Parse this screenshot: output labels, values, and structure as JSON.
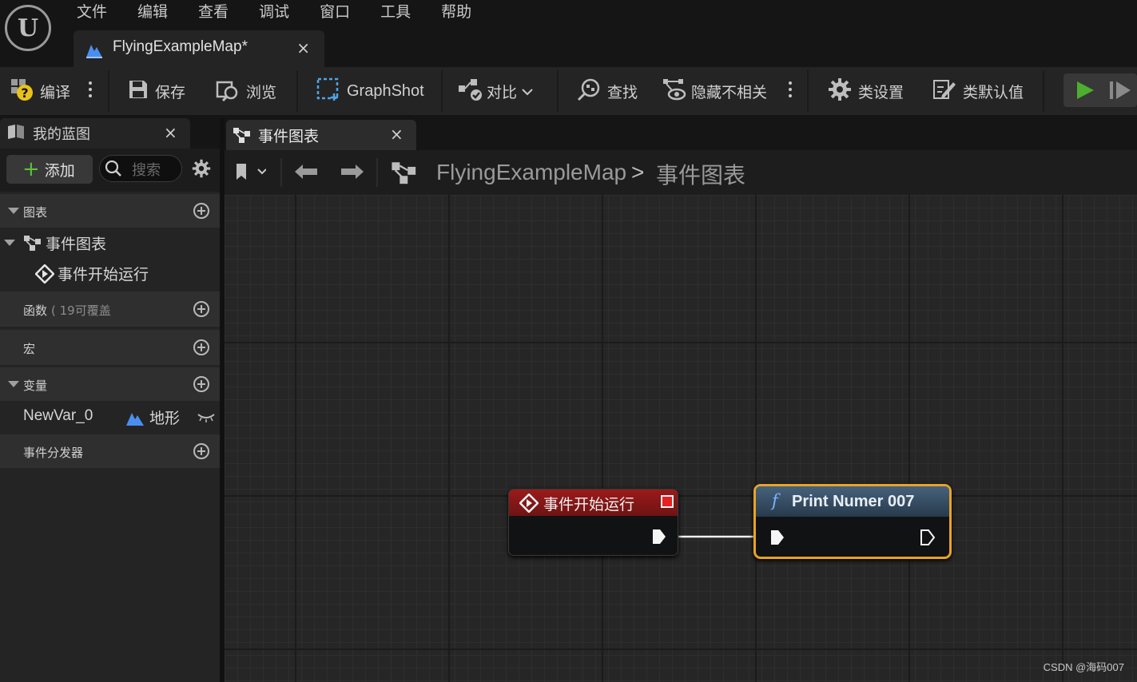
{
  "menu": [
    "文件",
    "编辑",
    "查看",
    "调试",
    "窗口",
    "工具",
    "帮助"
  ],
  "document_tab": {
    "label": "FlyingExampleMap*",
    "close": "×"
  },
  "toolbar": {
    "compile": "编译",
    "save": "保存",
    "browse": "浏览",
    "graphshot": "GraphShot",
    "diff": "对比",
    "find": "查找",
    "hide_unrelated": "隐藏不相关",
    "class_settings": "类设置",
    "class_defaults": "类默认值"
  },
  "my_blueprint": {
    "tab_label": "我的蓝图",
    "close": "×",
    "add_label": "添加",
    "search_placeholder": "搜索",
    "sections": {
      "graphs": "图表",
      "event_graph": "事件图表",
      "begin_play": "事件开始运行",
      "functions": "函数",
      "functions_count": "( 19可覆盖",
      "macros": "宏",
      "variables": "变量",
      "event_dispatchers": "事件分发器"
    },
    "variable": {
      "name": "NewVar_0",
      "type": "地形"
    }
  },
  "graph_tab": {
    "label": "事件图表",
    "close": "×"
  },
  "breadcrumb": {
    "root": "FlyingExampleMap",
    "separator": ">",
    "current": "事件图表"
  },
  "nodes": {
    "event": {
      "title": "事件开始运行"
    },
    "function": {
      "icon": "f",
      "title": "Print Numer 007"
    }
  },
  "watermark": "CSDN @海码007",
  "colors": {
    "event_header": "#9b1a1a",
    "function_header": "#46627c",
    "selection": "#e8a229",
    "play": "#4caf2e",
    "add_plus": "#5cc03a"
  }
}
